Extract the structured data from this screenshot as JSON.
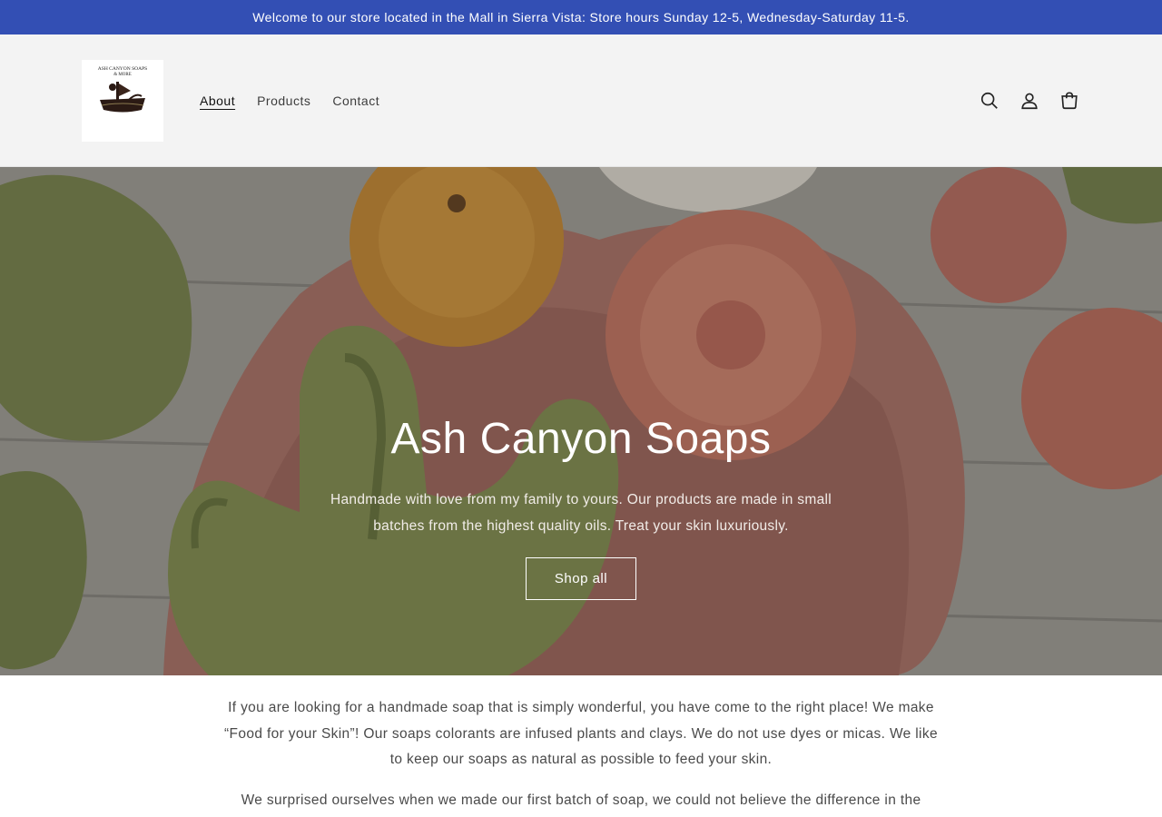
{
  "announcement": {
    "text": "Welcome to our store located in the Mall in Sierra Vista: Store hours Sunday 12-5, Wednesday-Saturday 11-5."
  },
  "header": {
    "logo_text_line1": "ASH CANYON SOAPS",
    "logo_text_line2": "& MORE",
    "nav": [
      {
        "label": "About",
        "active": true
      },
      {
        "label": "Products",
        "active": false
      },
      {
        "label": "Contact",
        "active": false
      }
    ],
    "icons": [
      "search-icon",
      "account-icon",
      "cart-icon"
    ]
  },
  "hero": {
    "title": "Ash Canyon Soaps",
    "text": "Handmade with love from my family to yours. Our products are made in small batches from the highest quality oils. Treat your skin luxuriously.",
    "button_label": "Shop all"
  },
  "intro": {
    "paragraph1": "If you are looking for a handmade soap that is simply wonderful, you have come to the right place! We make “Food for your Skin”! Our soaps colorants are infused plants and clays. We do not use dyes or micas. We like to keep our soaps as natural as possible to feed your skin.",
    "paragraph2": "We surprised ourselves when we made our first batch of soap, we could not believe the difference in the"
  },
  "colors": {
    "announcement_bg": "#334fb4",
    "header_bg": "#f3f3f3"
  }
}
